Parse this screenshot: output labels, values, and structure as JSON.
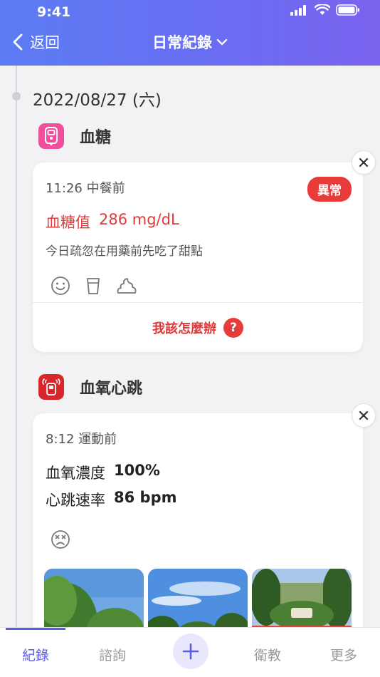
{
  "status_bar": {
    "time": "9:41"
  },
  "header": {
    "back_label": "返回",
    "title": "日常紀錄"
  },
  "date": "2022/08/27 (六)",
  "sections": [
    {
      "title": "血糖",
      "icon": "glucose-meter-icon",
      "icon_color": "#f04f9e",
      "card": {
        "time_label": "11:26 中餐前",
        "badge": "異常",
        "reading_label": "血糖值",
        "reading_value": "286 mg/dL",
        "note": "今日疏忽在用藥前先吃了甜點",
        "help_label": "我該怎麼辦",
        "help_icon": "?"
      }
    },
    {
      "title": "血氧心跳",
      "icon": "pulse-oximeter-icon",
      "icon_color": "#d8262b",
      "card": {
        "time_label": "8:12 運動前",
        "metrics": [
          {
            "label": "血氧濃度",
            "value": "100%"
          },
          {
            "label": "心跳速率",
            "value": "86 bpm"
          }
        ]
      }
    }
  ],
  "tabbar": {
    "tabs": [
      "紀錄",
      "諮詢",
      "衛教",
      "更多"
    ],
    "active": "紀錄"
  },
  "colors": {
    "accent": "#5b5de8",
    "alert": "#ea3b3b",
    "header_start": "#5b7cf4",
    "header_end": "#7a63ef"
  }
}
